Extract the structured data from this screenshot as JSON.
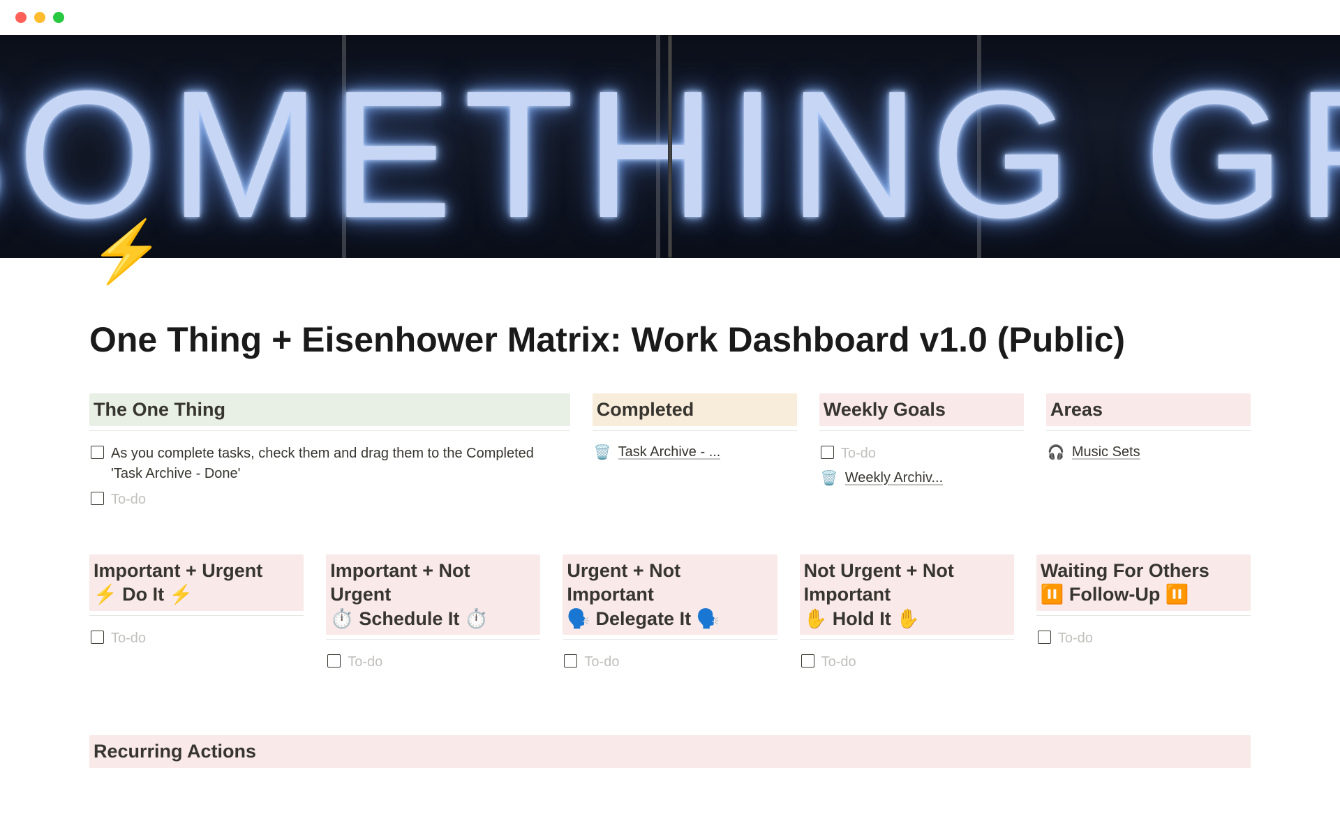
{
  "cover_text": "DO SOMETHING GREAT",
  "page_icon": "⚡",
  "page_title": "One Thing + Eisenhower Matrix: Work Dashboard v1.0 (Public)",
  "sections_top": {
    "one_thing": {
      "title": "The One Thing",
      "items": [
        {
          "text": "As you complete tasks, check them and drag them to the Completed 'Task Archive - Done'",
          "placeholder": false
        },
        {
          "text": "To-do",
          "placeholder": true
        }
      ]
    },
    "completed": {
      "title": "Completed",
      "links": [
        {
          "icon": "🗑️",
          "text": "Task Archive - ..."
        }
      ]
    },
    "weekly": {
      "title": "Weekly Goals",
      "items": [
        {
          "text": "To-do",
          "placeholder": true
        }
      ],
      "links": [
        {
          "icon": "🗑️",
          "text": "Weekly Archiv..."
        }
      ]
    },
    "areas": {
      "title": "Areas",
      "links": [
        {
          "icon": "🎧",
          "text": "Music Sets"
        }
      ]
    }
  },
  "matrix": [
    {
      "title": "Important + Urgent\n⚡ Do It ⚡",
      "todo": "To-do"
    },
    {
      "title": "Important + Not Urgent\n⏱️ Schedule It ⏱️",
      "todo": "To-do"
    },
    {
      "title": "Urgent + Not Important\n🗣️ Delegate It 🗣️",
      "todo": "To-do"
    },
    {
      "title": "Not Urgent + Not Important\n✋ Hold It ✋",
      "todo": "To-do"
    },
    {
      "title": "Waiting For Others\n⏸️ Follow-Up ⏸️",
      "todo": "To-do"
    }
  ],
  "recurring_title": "Recurring Actions"
}
